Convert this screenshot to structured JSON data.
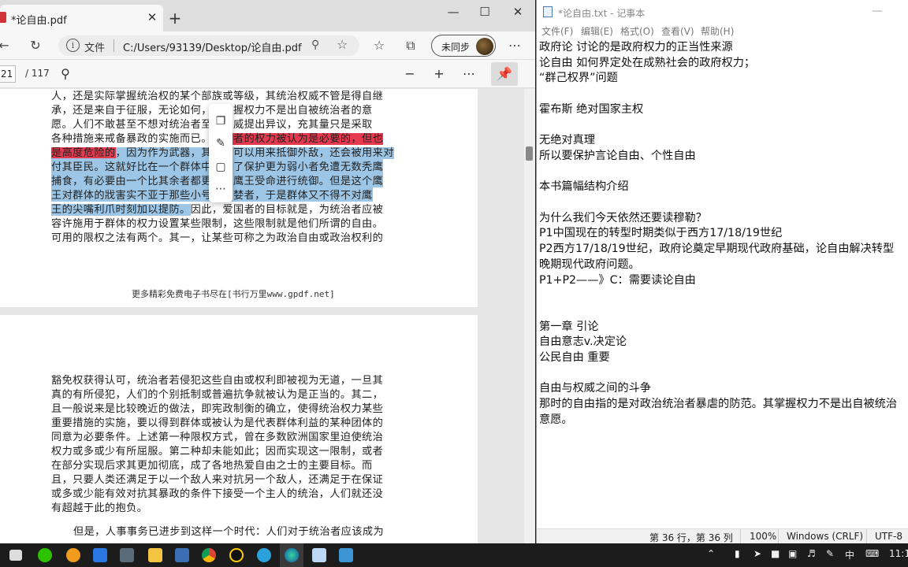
{
  "edge": {
    "tab_title": "*论自由.pdf",
    "tab_close": "✕",
    "new_tab": "+",
    "win_minimize": "—",
    "win_maximize": "☐",
    "win_close": "✕",
    "address": {
      "file_label": "文件",
      "path": "C:/Users/93139/Desktop/论自由.pdf",
      "info_glyph": "i"
    },
    "sync_label": "未同步",
    "pdf": {
      "page_current": "21",
      "page_total": "/ 117",
      "page1_lines": [
        "人，还是实际掌握统治权的某个部族或等级，其统治权威不管是得自继",
        "承，还是来自于征服，无论如何，其掌握权力不是出自被统治者的意",
        "愿。人们不敢甚至不想对统治者至上权威提出异议，充其量只是采取",
        "各种措施来戒备暴政的实施而已。"
      ],
      "hl_line5": {
        "red": "统治者的权力被认为是必要的，但也",
        "pre": "各种措施来戒备暴政的实施而已。"
      },
      "hl_line6_red": "是高度危险的",
      "hl_line6_blue": "，因为作为武器，其权力可以用来抵御外敌，还会被用来对",
      "hl_line7": "付其臣民。这就好比在一个群体中，为了保护更为弱小者免遭无数秃鹰",
      "hl_line8": "捕食，有必要由一个比其余者都更强的鹰王受命进行统御。但是这个鹰",
      "hl_line9": "王对群体的戕害实不亚于那些小号的贪婪者，于是群体又不得不对鹰",
      "hl_line10_blue": "王的尖嘴利爪时刻加以提防。",
      "line10_rest": "因此，爱国者的目标就是，为统治者应被",
      "line11": "容许施用于群体的权力设置某些限制，这些限制就是他们所谓的自由。",
      "line12": "可用的限权之法有两个。其一，让某些可称之为政治自由或政治权利的",
      "footer": "更多精彩免费电子书尽在[书行万里www.gpdf.net]",
      "page2_lines": [
        "豁免权获得认可，统治者若侵犯这些自由或权利即被视为无道，一旦其",
        "真的有所侵犯，人们的个别抵制或普遍抗争就被认为是正当的。其二，",
        "且一般说来是比较晚近的做法，即宪政制衡的确立，使得统治权力某些",
        "重要措施的实施，要以得到群体或被认为是代表群体利益的某种团体的",
        "同意为必要条件。上述第一种限权方式，曾在多数欧洲国家里迫使统治",
        "权力或多或少有所屈服。第二种却未能如此；因而实现这一限制，或者",
        "在部分实现后求其更加彻底，成了各地热爱自由之士的主要目标。而",
        "且，只要人类还满足于以一个敌人来对抗另一个敌人，还满足于在保证",
        "或多或少能有效对抗其暴政的条件下接受一个主人的统治，人们就还没",
        "有超越于此的抱负。",
        "但是，人事事务已进步到这样一个时代：人们对于统治者应该成为"
      ]
    }
  },
  "notepad": {
    "title": "*论自由.txt - 记事本",
    "menu": [
      "文件(F)",
      "编辑(E)",
      "格式(O)",
      "查看(V)",
      "帮助(H)"
    ],
    "lines": [
      "政府论 讨论的是政府权力的正当性来源",
      "论自由 如何界定处在成熟社会的政府权力；",
      "“群己权界”问题",
      "",
      "霍布斯 绝对国家主权",
      "",
      "无绝对真理",
      "所以要保护言论自由、个性自由",
      "",
      "本书篇幅结构介绍",
      "",
      "为什么我们今天依然还要读穆勒？",
      "P1中国现在的转型时期类似于西方17/18/19世纪",
      "P2西方17/18/19世纪，政府论奠定早期现代政府基础，论自由解决转型",
      "晚期现代政府问题。",
      "P1+P2——》C：需要读论自由",
      "",
      "",
      "第一章 引论",
      "自由意志v.决定论",
      "公民自由 重要",
      "",
      "自由与权威之间的斗争",
      "那时的自由指的是对政治统治者暴虐的防范。其掌握权力不是出自被统治",
      "意愿。"
    ],
    "status": {
      "position": "第 36 行，第 36 列",
      "zoom": "100%",
      "eol": "Windows (CRLF)",
      "encoding": "UTF-8"
    }
  },
  "taskbar": {
    "ime": "中",
    "clock": "11:1"
  }
}
